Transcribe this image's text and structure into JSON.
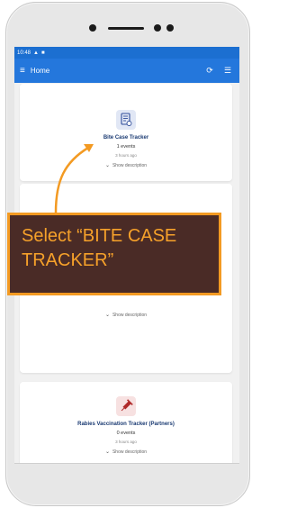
{
  "status_bar": {
    "time": "10:48"
  },
  "app_bar": {
    "title": "Home"
  },
  "programs": [
    {
      "name": "Bite Case Tracker",
      "events": "1 events",
      "updated": "3 hours ago",
      "show_description": "Show description"
    },
    {
      "name": "",
      "events": "",
      "updated": "",
      "show_description": "Show description"
    },
    {
      "name": "Rabies Vaccination Tracker (Partners)",
      "events": "0 events",
      "updated": "3 hours ago",
      "show_description": "Show description"
    }
  ],
  "callout": {
    "text": "Select “BITE CASE TRACKER”"
  },
  "colors": {
    "app_bar": "#2477dc",
    "callout_bg": "#4a2b26",
    "callout_accent": "#f39a22"
  },
  "icons": [
    "menu-icon",
    "sync-icon",
    "filter-icon",
    "form-icon",
    "syringe-icon",
    "chevron-down-icon"
  ]
}
